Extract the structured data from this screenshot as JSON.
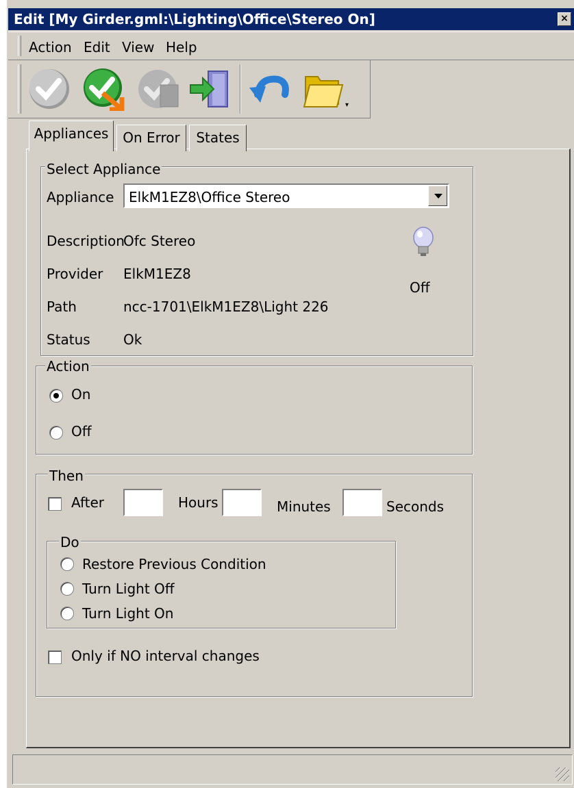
{
  "window": {
    "title": "Edit [My Girder.gml:\\Lighting\\Office\\Stereo On]",
    "close": "×"
  },
  "menu": {
    "items": [
      "Action",
      "Edit",
      "View",
      "Help"
    ]
  },
  "toolbar": {
    "buttons": [
      "ok-icon",
      "apply-icon",
      "disabled-icon",
      "exit-icon",
      "undo-icon",
      "folder-icon"
    ],
    "dropdown": "▾"
  },
  "tabs": [
    "Appliances",
    "On Error",
    "States"
  ],
  "select_appliance": {
    "legend": "Select Appliance",
    "appliance_label": "Appliance",
    "appliance_value": "ElkM1EZ8\\Office Stereo",
    "description_label": "Description",
    "description_value": "Ofc Stereo",
    "provider_label": "Provider",
    "provider_value": "ElkM1EZ8",
    "path_label": "Path",
    "path_value": "ncc-1701\\ElkM1EZ8\\Light 226",
    "status_label": "Status",
    "status_value": "Ok",
    "state_value": "Off"
  },
  "action": {
    "legend": "Action",
    "options": [
      "On",
      "Off"
    ],
    "selected": "On"
  },
  "then": {
    "legend": "Then",
    "after_label": "After",
    "hours_label": "Hours",
    "minutes_label": "Minutes",
    "seconds_label": "Seconds",
    "do_legend": "Do",
    "do_options": [
      "Restore Previous Condition",
      "Turn Light Off",
      "Turn Light On"
    ],
    "only_if_label": "Only if NO interval changes"
  },
  "colors": {
    "titlebar": "#0a246a",
    "face": "#d4d0c8"
  }
}
